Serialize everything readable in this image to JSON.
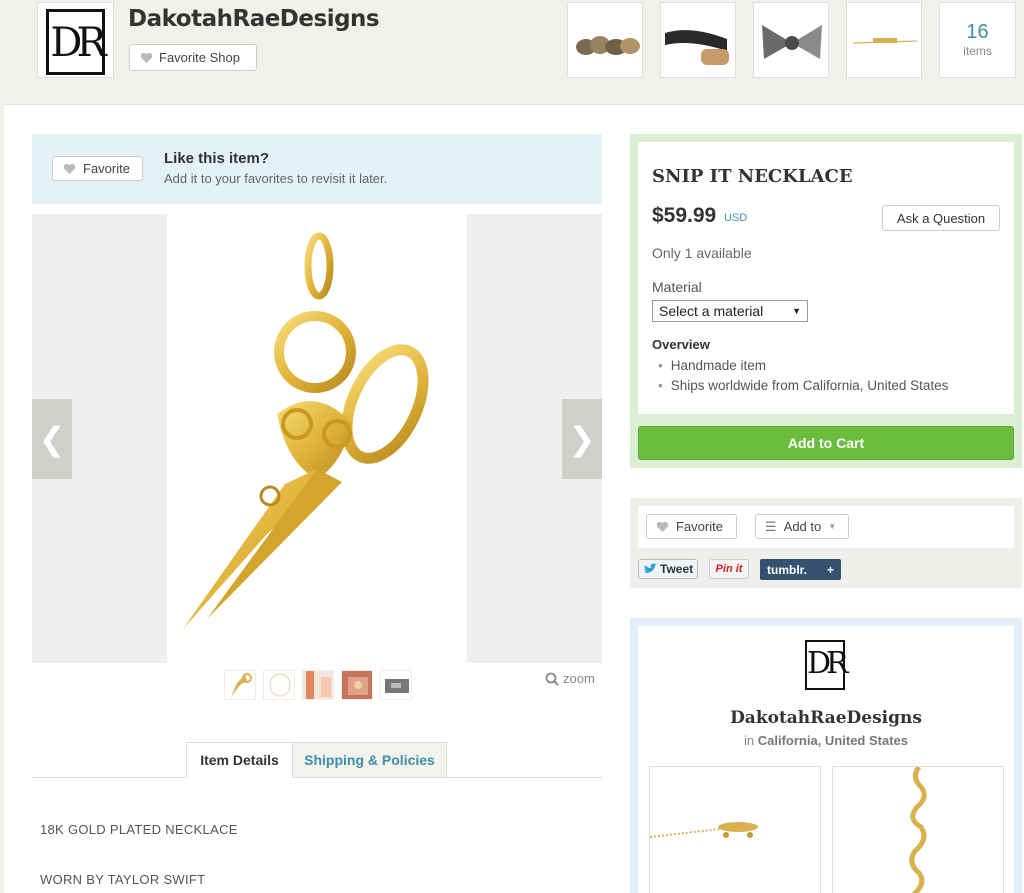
{
  "shop": {
    "logo_letters": "DR",
    "name": "DakotahRaeDesigns",
    "favorite_label": "Favorite Shop",
    "items_count": "16",
    "items_label": "items"
  },
  "favorite_bar": {
    "button_label": "Favorite",
    "title": "Like this item?",
    "subtitle": "Add it to your favorites to revisit it later."
  },
  "gallery": {
    "zoom_label": "zoom"
  },
  "tabs": {
    "details": "Item Details",
    "shipping": "Shipping & Policies"
  },
  "description": {
    "line1": "18K GOLD PLATED NECKLACE",
    "line2": "WORN BY TAYLOR SWIFT"
  },
  "product": {
    "title": "SNIP IT NECKLACE",
    "price": "$59.99",
    "currency": "USD",
    "ask_label": "Ask a Question",
    "availability": "Only 1 available",
    "material_label": "Material",
    "material_placeholder": "Select a material",
    "overview_title": "Overview",
    "overview_items": [
      "Handmade item",
      "Ships worldwide from California, United States"
    ],
    "add_to_cart": "Add to Cart"
  },
  "social": {
    "favorite_label": "Favorite",
    "add_to_label": "Add to",
    "tweet_label": "Tweet",
    "pinit_label": "Pin it",
    "tumblr_label": "tumblr."
  },
  "shop_card": {
    "logo_letters": "DR",
    "name": "DakotahRaeDesigns",
    "in_label": "in",
    "location": "California, United States"
  },
  "colors": {
    "accent_blue": "#3d8fa8",
    "cart_green": "#6bbe3d",
    "tumblr_blue": "#34526f"
  }
}
